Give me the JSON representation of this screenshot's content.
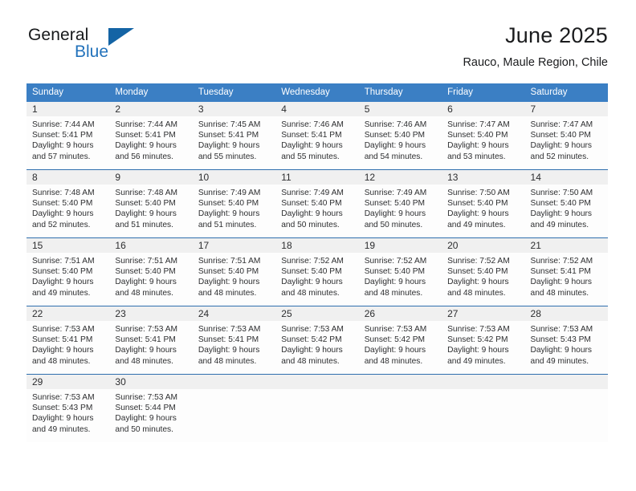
{
  "brand": {
    "name_part1": "General",
    "name_part2": "Blue",
    "triangle_color": "#1464a5",
    "blue_color": "#2272bb"
  },
  "header": {
    "title": "June 2025",
    "location": "Rauco, Maule Region, Chile"
  },
  "theme": {
    "header_bg": "#3b7fc4",
    "row_divider": "#2f6fae",
    "daynum_bg": "#f0f0f0",
    "text": "#2d2e30"
  },
  "weekdays": [
    "Sunday",
    "Monday",
    "Tuesday",
    "Wednesday",
    "Thursday",
    "Friday",
    "Saturday"
  ],
  "weeks": [
    [
      {
        "day": "1",
        "sunrise": "Sunrise: 7:44 AM",
        "sunset": "Sunset: 5:41 PM",
        "daylight_1": "Daylight: 9 hours",
        "daylight_2": "and 57 minutes."
      },
      {
        "day": "2",
        "sunrise": "Sunrise: 7:44 AM",
        "sunset": "Sunset: 5:41 PM",
        "daylight_1": "Daylight: 9 hours",
        "daylight_2": "and 56 minutes."
      },
      {
        "day": "3",
        "sunrise": "Sunrise: 7:45 AM",
        "sunset": "Sunset: 5:41 PM",
        "daylight_1": "Daylight: 9 hours",
        "daylight_2": "and 55 minutes."
      },
      {
        "day": "4",
        "sunrise": "Sunrise: 7:46 AM",
        "sunset": "Sunset: 5:41 PM",
        "daylight_1": "Daylight: 9 hours",
        "daylight_2": "and 55 minutes."
      },
      {
        "day": "5",
        "sunrise": "Sunrise: 7:46 AM",
        "sunset": "Sunset: 5:40 PM",
        "daylight_1": "Daylight: 9 hours",
        "daylight_2": "and 54 minutes."
      },
      {
        "day": "6",
        "sunrise": "Sunrise: 7:47 AM",
        "sunset": "Sunset: 5:40 PM",
        "daylight_1": "Daylight: 9 hours",
        "daylight_2": "and 53 minutes."
      },
      {
        "day": "7",
        "sunrise": "Sunrise: 7:47 AM",
        "sunset": "Sunset: 5:40 PM",
        "daylight_1": "Daylight: 9 hours",
        "daylight_2": "and 52 minutes."
      }
    ],
    [
      {
        "day": "8",
        "sunrise": "Sunrise: 7:48 AM",
        "sunset": "Sunset: 5:40 PM",
        "daylight_1": "Daylight: 9 hours",
        "daylight_2": "and 52 minutes."
      },
      {
        "day": "9",
        "sunrise": "Sunrise: 7:48 AM",
        "sunset": "Sunset: 5:40 PM",
        "daylight_1": "Daylight: 9 hours",
        "daylight_2": "and 51 minutes."
      },
      {
        "day": "10",
        "sunrise": "Sunrise: 7:49 AM",
        "sunset": "Sunset: 5:40 PM",
        "daylight_1": "Daylight: 9 hours",
        "daylight_2": "and 51 minutes."
      },
      {
        "day": "11",
        "sunrise": "Sunrise: 7:49 AM",
        "sunset": "Sunset: 5:40 PM",
        "daylight_1": "Daylight: 9 hours",
        "daylight_2": "and 50 minutes."
      },
      {
        "day": "12",
        "sunrise": "Sunrise: 7:49 AM",
        "sunset": "Sunset: 5:40 PM",
        "daylight_1": "Daylight: 9 hours",
        "daylight_2": "and 50 minutes."
      },
      {
        "day": "13",
        "sunrise": "Sunrise: 7:50 AM",
        "sunset": "Sunset: 5:40 PM",
        "daylight_1": "Daylight: 9 hours",
        "daylight_2": "and 49 minutes."
      },
      {
        "day": "14",
        "sunrise": "Sunrise: 7:50 AM",
        "sunset": "Sunset: 5:40 PM",
        "daylight_1": "Daylight: 9 hours",
        "daylight_2": "and 49 minutes."
      }
    ],
    [
      {
        "day": "15",
        "sunrise": "Sunrise: 7:51 AM",
        "sunset": "Sunset: 5:40 PM",
        "daylight_1": "Daylight: 9 hours",
        "daylight_2": "and 49 minutes."
      },
      {
        "day": "16",
        "sunrise": "Sunrise: 7:51 AM",
        "sunset": "Sunset: 5:40 PM",
        "daylight_1": "Daylight: 9 hours",
        "daylight_2": "and 48 minutes."
      },
      {
        "day": "17",
        "sunrise": "Sunrise: 7:51 AM",
        "sunset": "Sunset: 5:40 PM",
        "daylight_1": "Daylight: 9 hours",
        "daylight_2": "and 48 minutes."
      },
      {
        "day": "18",
        "sunrise": "Sunrise: 7:52 AM",
        "sunset": "Sunset: 5:40 PM",
        "daylight_1": "Daylight: 9 hours",
        "daylight_2": "and 48 minutes."
      },
      {
        "day": "19",
        "sunrise": "Sunrise: 7:52 AM",
        "sunset": "Sunset: 5:40 PM",
        "daylight_1": "Daylight: 9 hours",
        "daylight_2": "and 48 minutes."
      },
      {
        "day": "20",
        "sunrise": "Sunrise: 7:52 AM",
        "sunset": "Sunset: 5:40 PM",
        "daylight_1": "Daylight: 9 hours",
        "daylight_2": "and 48 minutes."
      },
      {
        "day": "21",
        "sunrise": "Sunrise: 7:52 AM",
        "sunset": "Sunset: 5:41 PM",
        "daylight_1": "Daylight: 9 hours",
        "daylight_2": "and 48 minutes."
      }
    ],
    [
      {
        "day": "22",
        "sunrise": "Sunrise: 7:53 AM",
        "sunset": "Sunset: 5:41 PM",
        "daylight_1": "Daylight: 9 hours",
        "daylight_2": "and 48 minutes."
      },
      {
        "day": "23",
        "sunrise": "Sunrise: 7:53 AM",
        "sunset": "Sunset: 5:41 PM",
        "daylight_1": "Daylight: 9 hours",
        "daylight_2": "and 48 minutes."
      },
      {
        "day": "24",
        "sunrise": "Sunrise: 7:53 AM",
        "sunset": "Sunset: 5:41 PM",
        "daylight_1": "Daylight: 9 hours",
        "daylight_2": "and 48 minutes."
      },
      {
        "day": "25",
        "sunrise": "Sunrise: 7:53 AM",
        "sunset": "Sunset: 5:42 PM",
        "daylight_1": "Daylight: 9 hours",
        "daylight_2": "and 48 minutes."
      },
      {
        "day": "26",
        "sunrise": "Sunrise: 7:53 AM",
        "sunset": "Sunset: 5:42 PM",
        "daylight_1": "Daylight: 9 hours",
        "daylight_2": "and 48 minutes."
      },
      {
        "day": "27",
        "sunrise": "Sunrise: 7:53 AM",
        "sunset": "Sunset: 5:42 PM",
        "daylight_1": "Daylight: 9 hours",
        "daylight_2": "and 49 minutes."
      },
      {
        "day": "28",
        "sunrise": "Sunrise: 7:53 AM",
        "sunset": "Sunset: 5:43 PM",
        "daylight_1": "Daylight: 9 hours",
        "daylight_2": "and 49 minutes."
      }
    ],
    [
      {
        "day": "29",
        "sunrise": "Sunrise: 7:53 AM",
        "sunset": "Sunset: 5:43 PM",
        "daylight_1": "Daylight: 9 hours",
        "daylight_2": "and 49 minutes."
      },
      {
        "day": "30",
        "sunrise": "Sunrise: 7:53 AM",
        "sunset": "Sunset: 5:44 PM",
        "daylight_1": "Daylight: 9 hours",
        "daylight_2": "and 50 minutes."
      },
      {
        "day": "",
        "sunrise": "",
        "sunset": "",
        "daylight_1": "",
        "daylight_2": ""
      },
      {
        "day": "",
        "sunrise": "",
        "sunset": "",
        "daylight_1": "",
        "daylight_2": ""
      },
      {
        "day": "",
        "sunrise": "",
        "sunset": "",
        "daylight_1": "",
        "daylight_2": ""
      },
      {
        "day": "",
        "sunrise": "",
        "sunset": "",
        "daylight_1": "",
        "daylight_2": ""
      },
      {
        "day": "",
        "sunrise": "",
        "sunset": "",
        "daylight_1": "",
        "daylight_2": ""
      }
    ]
  ]
}
